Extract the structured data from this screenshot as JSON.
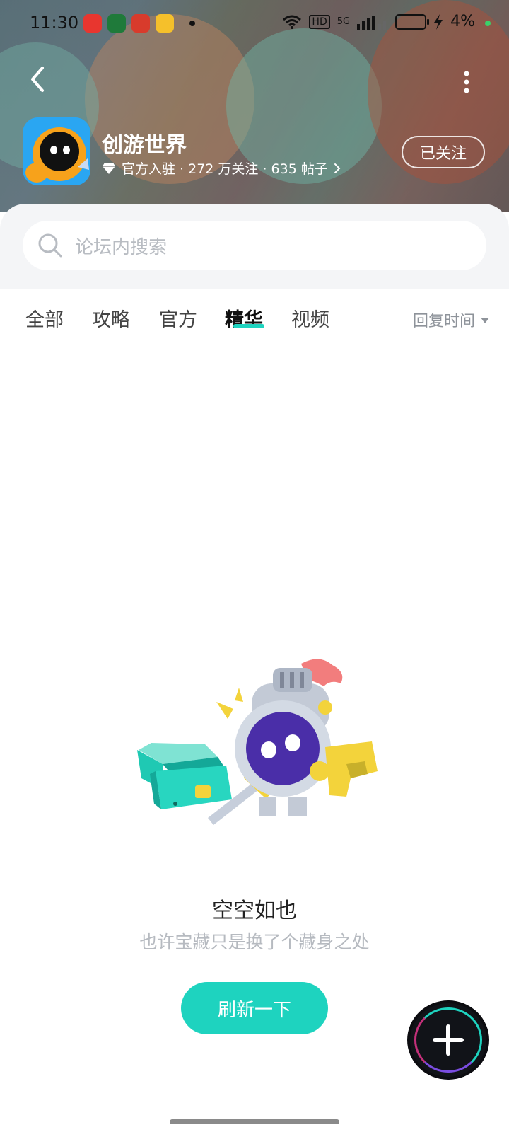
{
  "status_bar": {
    "time": "11:30",
    "network": "5G",
    "hd": "HD",
    "battery": "4%"
  },
  "header": {
    "forum_name": "创游世界",
    "meta": "官方入驻 · 272 万关注 · 635 帖子",
    "follow_label": "已关注"
  },
  "search": {
    "placeholder": "论坛内搜索"
  },
  "tabs": [
    "全部",
    "攻略",
    "官方",
    "精华",
    "视频"
  ],
  "active_tab": "精华",
  "sort": {
    "label": "回复时间"
  },
  "empty_state": {
    "title": "空空如也",
    "subtitle": "也许宝藏只是换了个藏身之处",
    "refresh_label": "刷新一下"
  },
  "colors": {
    "accent": "#1ed3bf",
    "tab_indicator": "#1ed3bf"
  }
}
